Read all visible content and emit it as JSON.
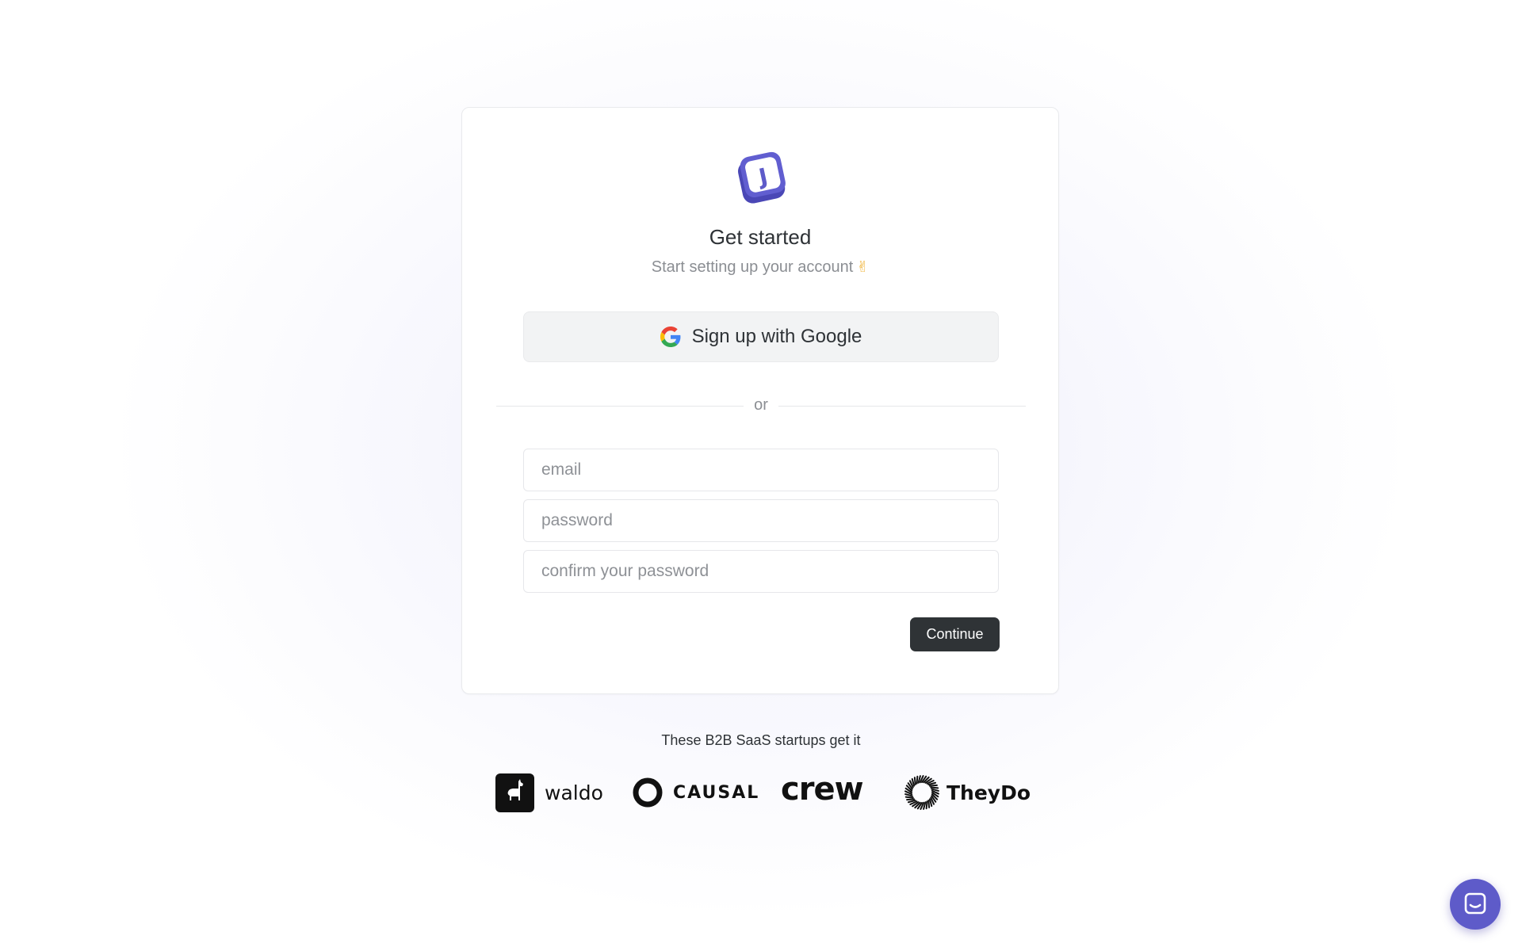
{
  "app": {
    "brand_color": "#5e5bc9",
    "logo_letter": "J"
  },
  "signup": {
    "title": "Get started",
    "subtitle": "Start setting up your account",
    "subtitle_emoji": "✌",
    "google_button": {
      "icon": "google-icon",
      "label": "Sign up with Google"
    },
    "divider_text": "or",
    "fields": {
      "email_placeholder": "email",
      "password_placeholder": "password",
      "confirm_placeholder": "confirm your password"
    },
    "continue_label": "Continue"
  },
  "social_proof": {
    "tagline": "These B2B SaaS startups get it",
    "logos": [
      {
        "name": "waldo",
        "icon": "llama-icon"
      },
      {
        "name": "CAUSAL",
        "icon": "ring-icon"
      },
      {
        "name": "crew",
        "icon": "none"
      },
      {
        "name": "TheyDo",
        "icon": "burst-icon"
      }
    ]
  },
  "chat_widget": {
    "icon": "chat-icon",
    "color": "#5e5bc9"
  }
}
